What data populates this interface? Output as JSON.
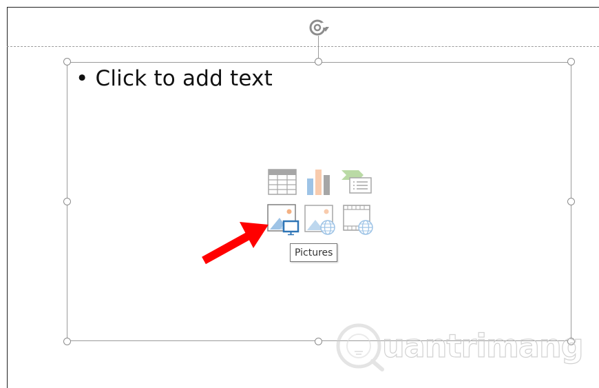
{
  "slide": {
    "placeholder_text": "Click to add text",
    "bullet": "•"
  },
  "content_icons": [
    {
      "name": "insert-table-icon",
      "label": "Table"
    },
    {
      "name": "insert-chart-icon",
      "label": "Chart"
    },
    {
      "name": "insert-smartart-icon",
      "label": "SmartArt"
    },
    {
      "name": "insert-pictures-icon",
      "label": "Pictures"
    },
    {
      "name": "insert-online-pictures-icon",
      "label": "Online Pictures"
    },
    {
      "name": "insert-video-icon",
      "label": "Video"
    }
  ],
  "tooltip": {
    "text": "Pictures"
  },
  "watermark": {
    "text": "uantrimang",
    "logo_letter": "Q"
  },
  "colors": {
    "arrow": "#ff0000",
    "handle_border": "#8c8c8c",
    "icon_blue": "#2e75b6",
    "icon_gray": "#a6a6a6",
    "icon_orange": "#f4b183"
  }
}
